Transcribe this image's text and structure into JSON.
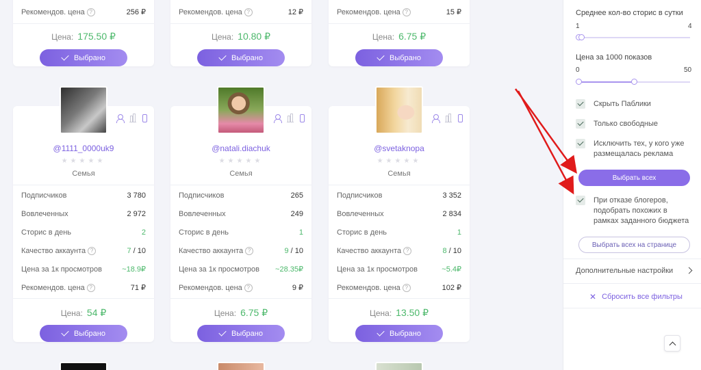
{
  "top_cards": [
    {
      "rec_label": "Рекомендов. цена",
      "rec_value": "256 ₽",
      "price_label": "Цена:",
      "price_value": "175.50 ₽",
      "button": "Выбрано"
    },
    {
      "rec_label": "Рекомендов. цена",
      "rec_value": "12 ₽",
      "price_label": "Цена:",
      "price_value": "10.80 ₽",
      "button": "Выбрано"
    },
    {
      "rec_label": "Рекомендов. цена",
      "rec_value": "15 ₽",
      "price_label": "Цена:",
      "price_value": "6.75 ₽",
      "button": "Выбрано"
    }
  ],
  "cards": [
    {
      "handle": "@1111_0000uk9",
      "category": "Семья",
      "rows": {
        "subscribers": "3 780",
        "engaged": "2 972",
        "stories": "2",
        "quality": "7",
        "quality_max": "/ 10",
        "price_1k": "~18.9₽",
        "rec": "71 ₽"
      },
      "price_label": "Цена:",
      "price_value": "54 ₽",
      "button": "Выбрано",
      "avatar_colors": [
        "#3a3a3a",
        "#bdbdbd"
      ]
    },
    {
      "handle": "@natali.diachuk",
      "category": "Семья",
      "rows": {
        "subscribers": "265",
        "engaged": "249",
        "stories": "1",
        "quality": "9",
        "quality_max": "/ 10",
        "price_1k": "~28.35₽",
        "rec": "9 ₽"
      },
      "price_label": "Цена:",
      "price_value": "6.75 ₽",
      "button": "Выбрано",
      "avatar_colors": [
        "#6a8c3a",
        "#e89ab0"
      ]
    },
    {
      "handle": "@svetaknopa",
      "category": "Семья",
      "rows": {
        "subscribers": "3 352",
        "engaged": "2 834",
        "stories": "1",
        "quality": "8",
        "quality_max": "/ 10",
        "price_1k": "~5.4₽",
        "rec": "102 ₽"
      },
      "price_label": "Цена:",
      "price_value": "13.50 ₽",
      "button": "Выбрано",
      "avatar_colors": [
        "#e8c27a",
        "#f3dfb8"
      ]
    }
  ],
  "labels": {
    "subscribers": "Подписчиков",
    "engaged": "Вовлеченных",
    "stories": "Сторис в день",
    "quality": "Качество аккаунта",
    "price_1k": "Цена за 1к просмотров",
    "rec": "Рекомендов. цена",
    "stars": "★★★★★"
  },
  "sidebar": {
    "stories_title": "Среднее кол-во сторис в сутки",
    "stories_min": "1",
    "stories_max": "4",
    "price_title": "Цена за 1000 показов",
    "price_min": "0",
    "price_max": "50",
    "cb_hide_publics": "Скрыть Паблики",
    "cb_only_free": "Только свободные",
    "cb_exclude_1": "Исключить тех, у кого уже",
    "cb_exclude_2": "размещалась реклама",
    "select_all": "Выбрать всех",
    "cb_similar_1": "При отказе блогеров,",
    "cb_similar_2": "подобрать похожих в",
    "cb_similar_3": "рамках заданного бюджета",
    "select_page": "Выбрать всех на странице",
    "advanced": "Дополнительные настройки",
    "reset": "Сбросить все фильтры"
  },
  "colors": {
    "accent": "#7c61e0",
    "green": "#4cb86b",
    "arrow": "#e01b1b"
  }
}
